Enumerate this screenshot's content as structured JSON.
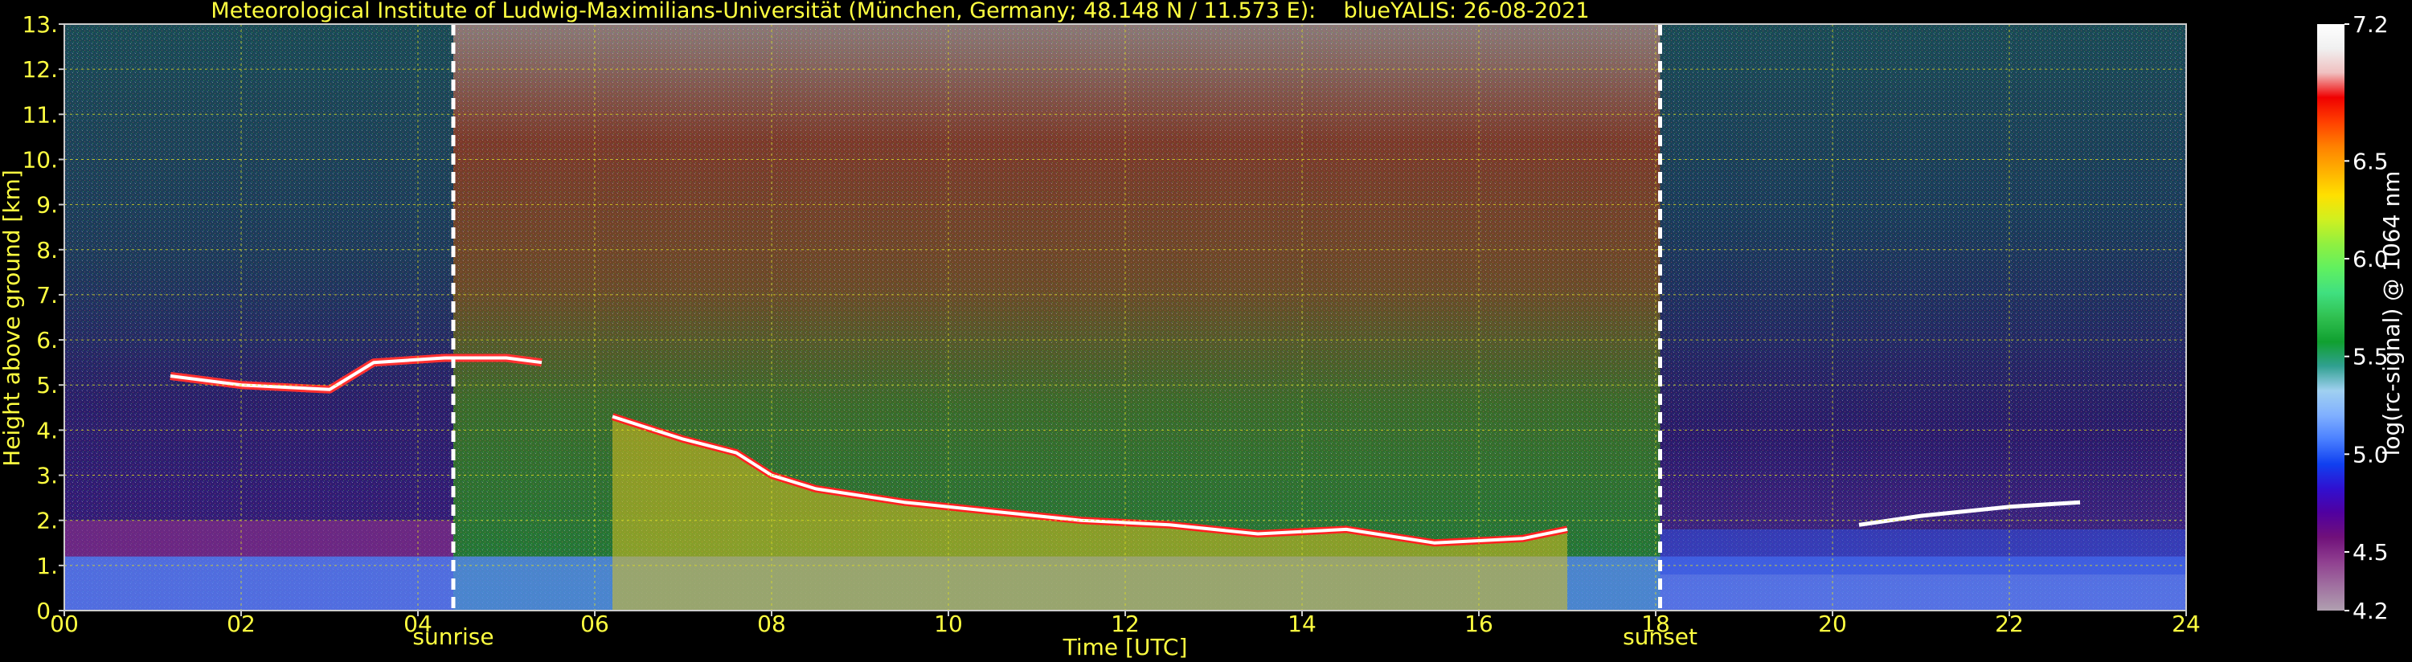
{
  "chart_data": {
    "type": "heatmap",
    "title": "Meteorological Institute of Ludwig-Maximilians-Universität (München, Germany; 48.148 N / 11.573 E):    blueYALIS: 26-08-2021",
    "xlabel": "Time [UTC]",
    "ylabel": "Height above ground [km]",
    "xlim": [
      0,
      24
    ],
    "ylim": [
      0,
      13
    ],
    "x_ticks": [
      "00",
      "02",
      "04",
      "06",
      "08",
      "10",
      "12",
      "14",
      "16",
      "18",
      "20",
      "22",
      "24"
    ],
    "x_tick_values": [
      0,
      2,
      4,
      6,
      8,
      10,
      12,
      14,
      16,
      18,
      20,
      22,
      24
    ],
    "y_ticks": [
      "0.",
      "1.",
      "2.",
      "3.",
      "4.",
      "5.",
      "6.",
      "7.",
      "8.",
      "9.",
      "10.",
      "11.",
      "12.",
      "13."
    ],
    "y_tick_values": [
      0,
      1,
      2,
      3,
      4,
      5,
      6,
      7,
      8,
      9,
      10,
      11,
      12,
      13
    ],
    "grid": true,
    "markers": [
      {
        "label": "sunrise",
        "x": 4.4
      },
      {
        "label": "sunset",
        "x": 18.05
      }
    ],
    "colorbar": {
      "label": "log(rc-signal) @ 1064 nm",
      "range": [
        4.2,
        7.2
      ],
      "tick_labels": [
        "4.2",
        "4.5",
        "5.0",
        "5.5",
        "6.0",
        "6.5",
        "7.2"
      ],
      "tick_values": [
        4.2,
        4.5,
        5.0,
        5.5,
        6.0,
        6.5,
        7.2
      ],
      "colors": [
        "#b0a0b0",
        "#a070a0",
        "#904090",
        "#70107a",
        "#5000a0",
        "#3010d0",
        "#1040f0",
        "#4a80ff",
        "#80b0ff",
        "#a0d0f0",
        "#30a090",
        "#10a030",
        "#30c050",
        "#40e080",
        "#60f060",
        "#90f040",
        "#d0f020",
        "#ffe000",
        "#ffb000",
        "#ff8000",
        "#ff4000",
        "#f00000",
        "#f0c0c0",
        "#f0f0f0",
        "#ffffff"
      ]
    },
    "features": {
      "cloud_layer": [
        {
          "x": 1.2,
          "y": 5.2
        },
        {
          "x": 2.0,
          "y": 5.0
        },
        {
          "x": 3.0,
          "y": 4.9
        },
        {
          "x": 3.5,
          "y": 5.5
        },
        {
          "x": 4.3,
          "y": 5.6
        },
        {
          "x": 5.0,
          "y": 5.6
        },
        {
          "x": 5.4,
          "y": 5.5
        }
      ],
      "pbl_top": [
        {
          "x": 6.2,
          "y": 4.3
        },
        {
          "x": 7.0,
          "y": 3.8
        },
        {
          "x": 7.6,
          "y": 3.5
        },
        {
          "x": 8.0,
          "y": 3.0
        },
        {
          "x": 8.5,
          "y": 2.7
        },
        {
          "x": 9.5,
          "y": 2.4
        },
        {
          "x": 10.5,
          "y": 2.2
        },
        {
          "x": 11.5,
          "y": 2.0
        },
        {
          "x": 12.5,
          "y": 1.9
        },
        {
          "x": 13.5,
          "y": 1.7
        },
        {
          "x": 14.5,
          "y": 1.8
        },
        {
          "x": 15.5,
          "y": 1.5
        },
        {
          "x": 16.5,
          "y": 1.6
        },
        {
          "x": 17.0,
          "y": 1.8
        }
      ],
      "night_layer": [
        {
          "x": 20.3,
          "y": 1.9
        },
        {
          "x": 21.0,
          "y": 2.1
        },
        {
          "x": 22.0,
          "y": 2.3
        },
        {
          "x": 22.8,
          "y": 2.4
        }
      ]
    }
  }
}
